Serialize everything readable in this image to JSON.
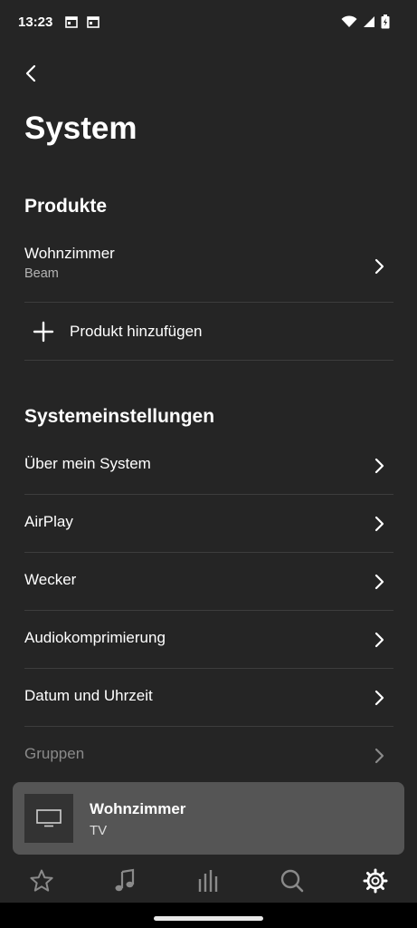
{
  "status": {
    "time": "13:23"
  },
  "page": {
    "title": "System"
  },
  "products": {
    "title": "Produkte",
    "items": [
      {
        "label": "Wohnzimmer",
        "sub": "Beam"
      }
    ],
    "add_label": "Produkt hinzufügen"
  },
  "settings": {
    "title": "Systemeinstellungen",
    "items": [
      {
        "label": "Über mein System"
      },
      {
        "label": "AirPlay"
      },
      {
        "label": "Wecker"
      },
      {
        "label": "Audiokomprimierung"
      },
      {
        "label": "Datum und Uhrzeit"
      },
      {
        "label": "Gruppen"
      }
    ]
  },
  "now_playing": {
    "title": "Wohnzimmer",
    "sub": "TV"
  },
  "tabs": [
    "favorites-icon",
    "music-icon",
    "rooms-icon",
    "search-icon",
    "settings-icon"
  ],
  "colors": {
    "background": "#252525",
    "card": "#555555",
    "active_tab": "#ffffff",
    "inactive_tab": "#8a8a8a"
  }
}
